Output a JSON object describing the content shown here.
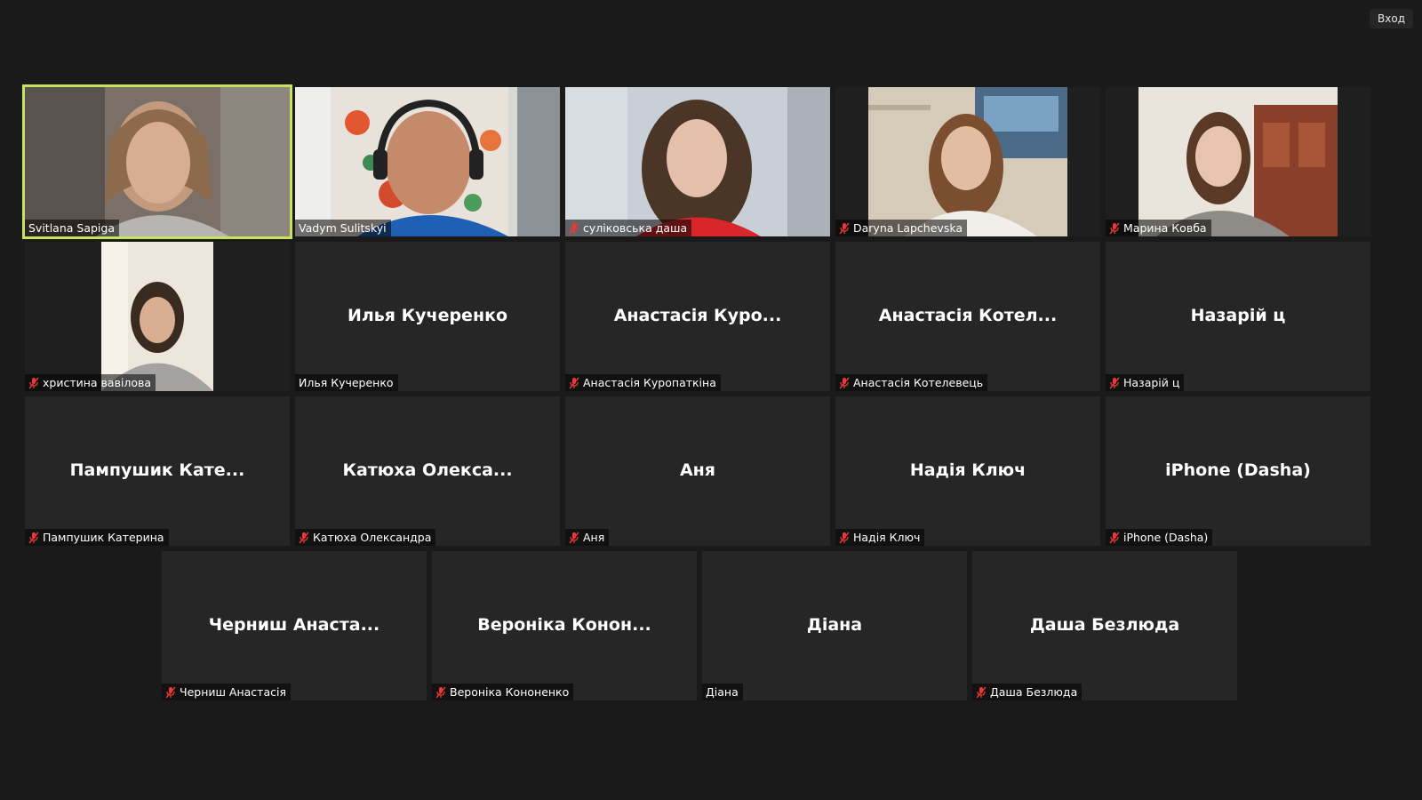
{
  "top_button": "Вход",
  "colors": {
    "speaking_border": "#c6e35a",
    "muted_icon": "#e8393a",
    "tile_bg": "#262626"
  },
  "participants": [
    {
      "label": "Svitlana Sapiga",
      "muted": false,
      "video": true,
      "speaking": true
    },
    {
      "label": "Vadym Sulitskyi",
      "muted": false,
      "video": true
    },
    {
      "label": "суліковська даша",
      "muted": true,
      "video": true
    },
    {
      "label": "Daryna Lapchevska",
      "muted": true,
      "video": true
    },
    {
      "label": "Марина Ковба",
      "muted": true,
      "video": true
    },
    {
      "label": "христина вавілова",
      "muted": true,
      "video": true
    },
    {
      "label": "Илья Кучеренко",
      "display": "Илья Кучеренко",
      "muted": false,
      "video": false
    },
    {
      "label": "Анастасія Куропаткіна",
      "display": "Анастасія  Куро...",
      "muted": true,
      "video": false
    },
    {
      "label": "Анастасія Котелевець",
      "display": "Анастасія  Котел...",
      "muted": true,
      "video": false
    },
    {
      "label": "Назарій ц",
      "display": "Назарій ц",
      "muted": true,
      "video": false
    },
    {
      "label": "Пампушик Катерина",
      "display": "Пампушик  Кате...",
      "muted": true,
      "video": false
    },
    {
      "label": "Катюха Олександра",
      "display": "Катюха  Олекса...",
      "muted": true,
      "video": false
    },
    {
      "label": "Аня",
      "display": "Аня",
      "muted": true,
      "video": false
    },
    {
      "label": "Надія Ключ",
      "display": "Надія Ключ",
      "muted": true,
      "video": false
    },
    {
      "label": "iPhone (Dasha)",
      "display": "iPhone (Dasha)",
      "muted": true,
      "video": false
    },
    {
      "label": "Черниш Анастасія",
      "display": "Черниш  Анаста...",
      "muted": true,
      "video": false
    },
    {
      "label": "Вероніка Кононенко",
      "display": "Вероніка  Конон...",
      "muted": true,
      "video": false
    },
    {
      "label": "Діана",
      "display": "Діана",
      "muted": false,
      "video": false
    },
    {
      "label": "Даша Безлюда",
      "display": "Даша Безлюда",
      "muted": true,
      "video": false
    }
  ]
}
